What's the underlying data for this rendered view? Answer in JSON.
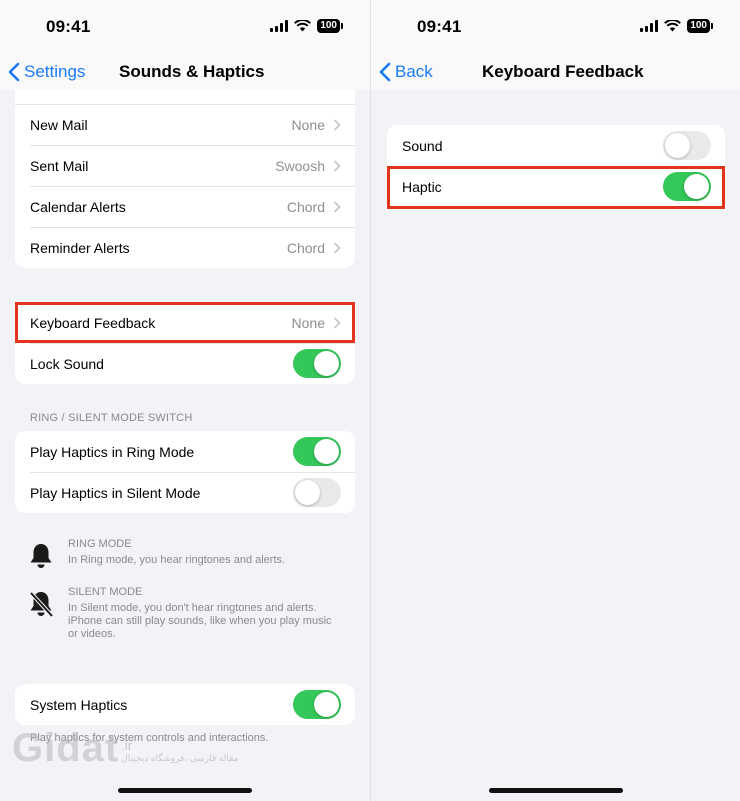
{
  "left": {
    "status": {
      "time": "09:41",
      "battery": "100"
    },
    "nav": {
      "back_label": "Settings",
      "title": "Sounds & Haptics"
    },
    "sounds_rows": [
      {
        "label": "New Mail",
        "value": "None"
      },
      {
        "label": "Sent Mail",
        "value": "Swoosh"
      },
      {
        "label": "Calendar Alerts",
        "value": "Chord"
      },
      {
        "label": "Reminder Alerts",
        "value": "Chord"
      }
    ],
    "keyboard_feedback": {
      "label": "Keyboard Feedback",
      "value": "None"
    },
    "lock_sound": {
      "label": "Lock Sound",
      "on": true
    },
    "ring_section_header": "RING / SILENT MODE SWITCH",
    "play_ring": {
      "label": "Play Haptics in Ring Mode",
      "on": true
    },
    "play_silent": {
      "label": "Play Haptics in Silent Mode",
      "on": false
    },
    "ring_info": {
      "title": "RING MODE",
      "text": "In Ring mode, you hear ringtones and alerts.",
      "icon": "bell-icon"
    },
    "silent_info": {
      "title": "SILENT MODE",
      "text": "In Silent mode, you don't hear ringtones and alerts. iPhone can still play sounds, like when you play music or videos.",
      "icon": "bell-slash-icon"
    },
    "system_haptics": {
      "label": "System Haptics",
      "on": true
    },
    "system_haptics_footnote": "Play haptics for system controls and interactions."
  },
  "right": {
    "status": {
      "time": "09:41",
      "battery": "100"
    },
    "nav": {
      "back_label": "Back",
      "title": "Keyboard Feedback"
    },
    "sound": {
      "label": "Sound",
      "on": false
    },
    "haptic": {
      "label": "Haptic",
      "on": true
    }
  },
  "watermark": {
    "logo": "Gidat",
    "domain": ".ir",
    "tagline": "مقاله فارسی ،فروشگاه دیجیتال"
  },
  "colors": {
    "accent": "#1a7af8",
    "toggle_on": "#34c759",
    "highlight": "#e0351b"
  }
}
